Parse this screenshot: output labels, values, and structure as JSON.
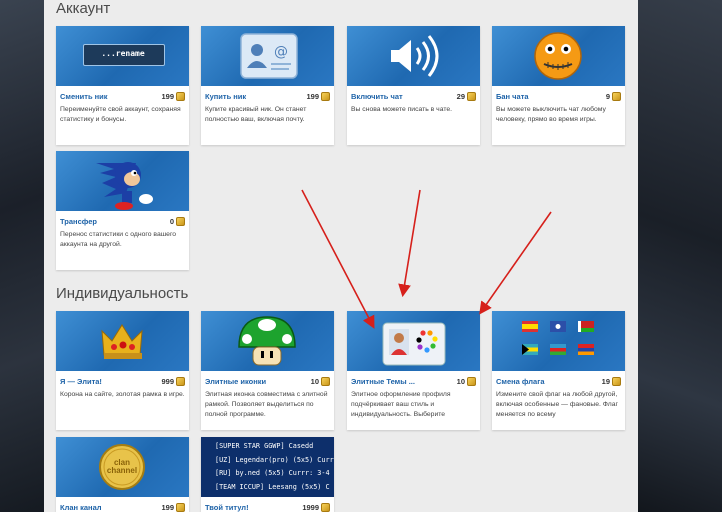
{
  "sections": {
    "account": "Аккаунт",
    "individuality": "Индивидуальность"
  },
  "cards": [
    {
      "name": "Сменить ник",
      "price": "199",
      "desc": "Переименуйте свой аккаунт, сохраняя статистику и бонусы.",
      "icon": "rename-terminal-icon",
      "thumb_text": "...rename"
    },
    {
      "name": "Купить ник",
      "price": "199",
      "desc": "Купите красивый ник. Он станет полностью ваш, включая почту.",
      "icon": "contact-card-icon"
    },
    {
      "name": "Включить чат",
      "price": "29",
      "desc": "Вы снова можете писать в чате.",
      "icon": "speaker-icon"
    },
    {
      "name": "Бан чата",
      "price": "9",
      "desc": "Вы можете выключить чат любому человеку, прямо во время игры.",
      "icon": "zipped-mouth-smiley-icon"
    },
    {
      "name": "Трансфер",
      "price": "0",
      "desc": "Перенос статистики с одного вашего аккаунта на другой.",
      "icon": "sonic-character-icon"
    },
    {
      "name": "Я — Элита!",
      "price": "999",
      "desc": "Корона на сайте, золотая рамка в игре.",
      "icon": "crown-icon"
    },
    {
      "name": "Элитные иконки",
      "price": "10",
      "desc": "Элитная иконка совместима с элитной рамкой. Позволяет выделиться по полной программе.",
      "icon": "mushroom-icon"
    },
    {
      "name": "Элитные Темы ...",
      "price": "10",
      "desc": "Элитное оформление профиля подчёркивает ваш стиль и индивидуальность. Выберите",
      "icon": "theme-palette-icon"
    },
    {
      "name": "Смена флага",
      "price": "19",
      "desc": "Измените свой флаг на любой другой, включая особенные — фановые. Флаг меняется по всему",
      "icon": "flags-icon"
    },
    {
      "name": "Клан канал",
      "price": "199",
      "desc": "",
      "icon": "clan-channel-coin-icon",
      "thumb_text": "clan channel"
    },
    {
      "name": "Твой титул!",
      "price": "1999",
      "desc": "",
      "icon": "title-list-icon",
      "thumb_lines": [
        "[SUPER STAR GGWP] Casedd",
        "[UZ] Legendar(pro) (5x5) Curr",
        "[RU] by.ned (5x5) Currr: 3-4 (",
        "[TEAM ICCUP] Leesang (5x5) C"
      ]
    }
  ],
  "colors": {
    "accent": "#1e63a8",
    "arrow": "#d6201b",
    "thumb": "#2a77c2"
  }
}
